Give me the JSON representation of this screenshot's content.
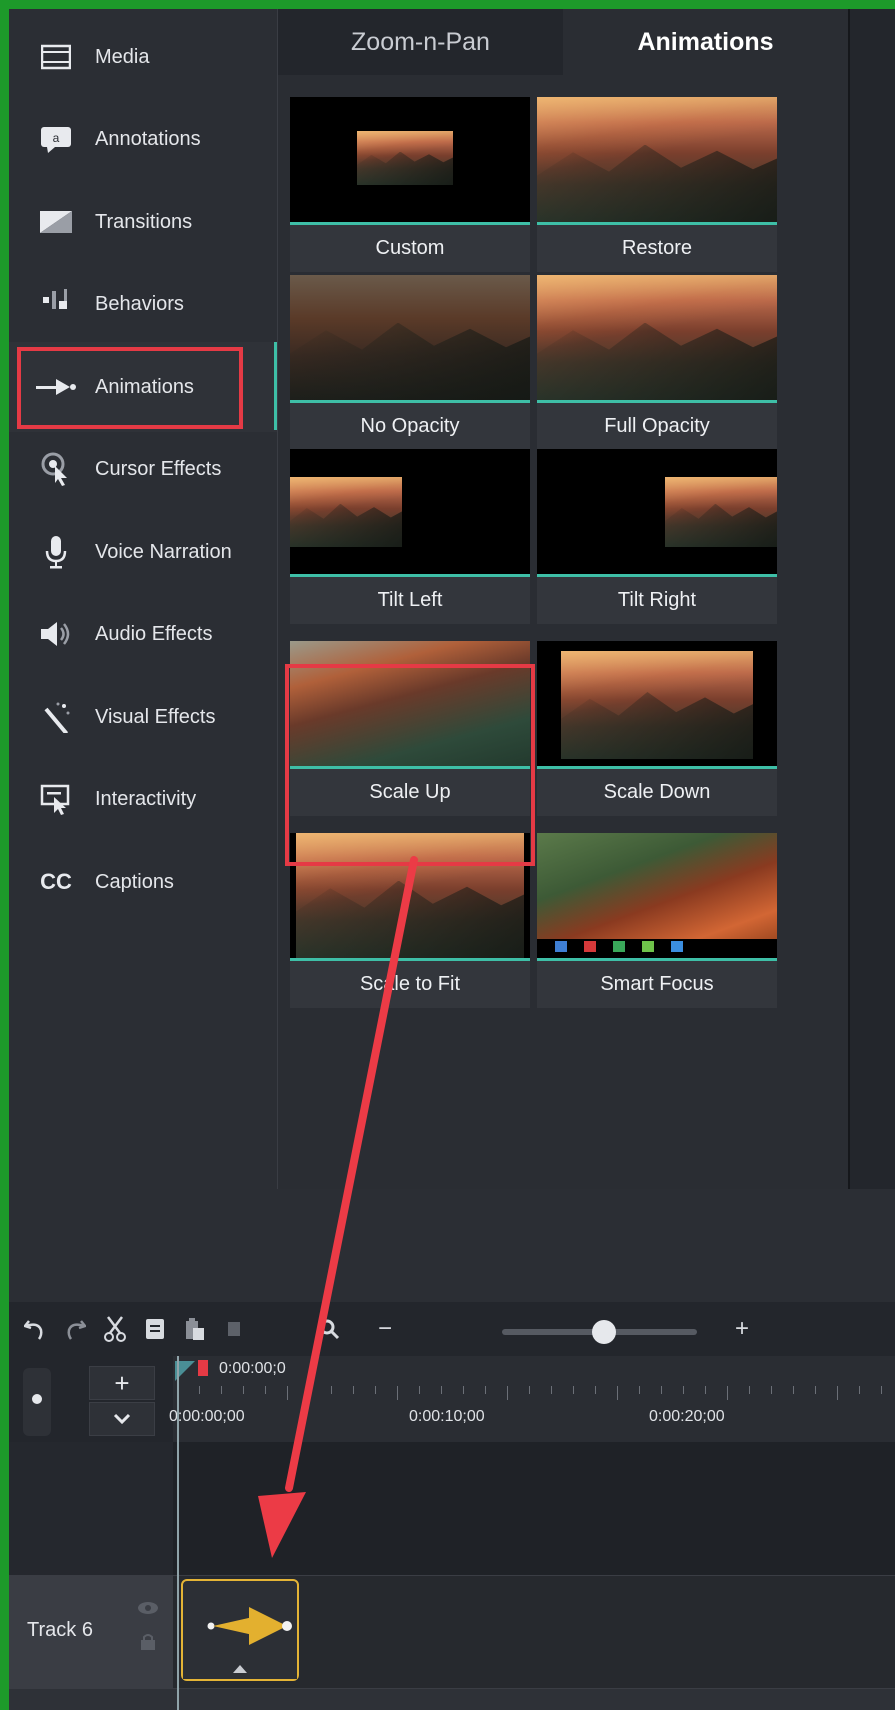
{
  "sidebar": {
    "items": [
      {
        "label": "Media",
        "icon": "film-icon"
      },
      {
        "label": "Annotations",
        "icon": "speech-bubble-icon"
      },
      {
        "label": "Transitions",
        "icon": "transition-icon"
      },
      {
        "label": "Behaviors",
        "icon": "behaviors-icon"
      },
      {
        "label": "Animations",
        "icon": "animation-arrow-icon",
        "active": true
      },
      {
        "label": "Cursor Effects",
        "icon": "cursor-effects-icon"
      },
      {
        "label": "Voice Narration",
        "icon": "microphone-icon"
      },
      {
        "label": "Audio Effects",
        "icon": "speaker-icon"
      },
      {
        "label": "Visual Effects",
        "icon": "magic-wand-icon"
      },
      {
        "label": "Interactivity",
        "icon": "interactivity-icon"
      },
      {
        "label": "Captions",
        "icon": "cc-icon"
      }
    ]
  },
  "tabs": [
    {
      "label": "Zoom-n-Pan",
      "selected": false
    },
    {
      "label": "Animations",
      "selected": true
    }
  ],
  "animations": [
    {
      "label": "Custom"
    },
    {
      "label": "Restore"
    },
    {
      "label": "No Opacity"
    },
    {
      "label": "Full Opacity"
    },
    {
      "label": "Tilt Left"
    },
    {
      "label": "Tilt Right"
    },
    {
      "label": "Scale Up",
      "highlighted": true
    },
    {
      "label": "Scale Down"
    },
    {
      "label": "Scale to Fit"
    },
    {
      "label": "Smart Focus"
    }
  ],
  "toolbar": {
    "icons": [
      "undo-icon",
      "redo-icon",
      "cut-icon",
      "copy-icon",
      "paste-icon",
      "split-icon",
      "zoom-search-icon"
    ],
    "zoom_minus": "−",
    "zoom_plus": "+",
    "zoom_level": 0.5
  },
  "timeline": {
    "playhead_time": "0:00:00;0",
    "ruler_labels": [
      "0:00:00;00",
      "0:00:10;00",
      "0:00:20;00"
    ]
  },
  "tracks": [
    {
      "label": "Track 6"
    }
  ],
  "colors": {
    "accent": "#3ebfa7",
    "highlight": "#e53a45",
    "clip_border": "#e4b436",
    "frame": "#1d9a2a"
  }
}
